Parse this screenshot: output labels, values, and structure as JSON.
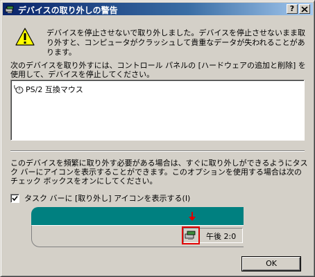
{
  "window": {
    "title": "デバイスの取り外しの警告",
    "help_button": "?",
    "close_button": "X"
  },
  "message": "デバイスを停止させないで取り外しました。デバイスを停止させないまま取り外すと、コンピュータがクラッシュして貴重なデータが失われることがあります。",
  "instruction": "次のデバイスを取り外すには、コントロール パネルの [ハードウェアの追加と削除] を使用して、デバイスを停止してください。",
  "devices": [
    {
      "label": "PS/2 互換マウス",
      "icon": "mouse-icon"
    }
  ],
  "description": "このデバイスを頻繁に取り外す必要がある場合は、すぐに取り外しができるようにタスク バーにアイコンを表示することができます。このオプションを使用する場合は次のチェック ボックスをオンにしてください。",
  "checkbox": {
    "label": "タスク バーに [取り外し] アイコンを表示する(I)",
    "checked": true
  },
  "taskbar_preview": {
    "clock": "午後 2:0",
    "icon": "eject-hardware-icon"
  },
  "ok_button": "OK",
  "colors": {
    "titlebar_start": "#0a246a",
    "titlebar_end": "#a6caf0",
    "desktop_teal": "#008080",
    "highlight_red": "#e00000"
  }
}
